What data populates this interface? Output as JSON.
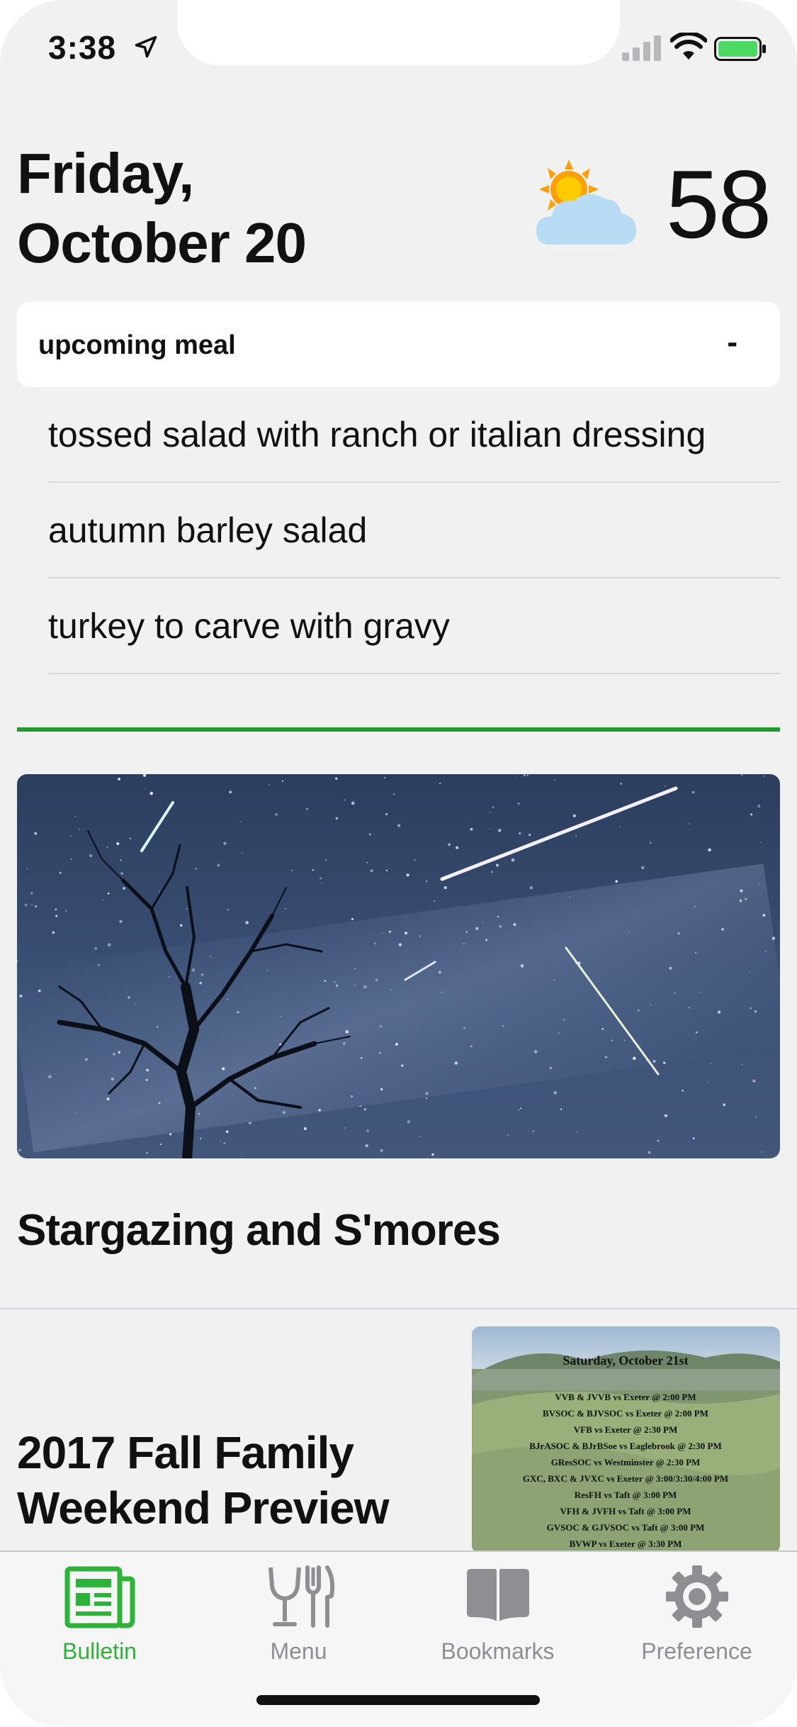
{
  "status_bar": {
    "time": "3:38"
  },
  "header": {
    "date_line1": "Friday,",
    "date_line2": "October 20",
    "temperature": "58",
    "weather_icon": "partly-cloudy-icon"
  },
  "meal": {
    "title": "upcoming meal",
    "toggle": "-",
    "items": [
      "tossed salad with ranch or italian dressing",
      "autumn barley salad",
      "turkey to carve with gravy"
    ]
  },
  "news": [
    {
      "title": "Stargazing and S'mores"
    },
    {
      "title_line1": "2017 Fall Family",
      "title_line2": "Weekend Preview",
      "thumbnail": {
        "heading": "Saturday, October 21st",
        "lines": [
          "VVB & JVVB vs Exeter @ 2:00 PM",
          "BVSOC & BJVSOC vs Exeter @ 2:00 PM",
          "VFB vs Exeter @ 2:30 PM",
          "BJrASOC & BJrBSoe vs Eaglebrook @ 2:30 PM",
          "GResSOC vs Westminster @ 2:30 PM",
          "GXC, BXC & JVXC vs Exeter @ 3:00/3:30/4:00 PM",
          "ResFH vs Taft @ 3:00 PM",
          "VFH & JVFH vs Taft @ 3:00 PM",
          "GVSOC & GJVSOC vs Taft @ 3:00 PM",
          "BVWP vs Exeter @ 3:30 PM"
        ]
      }
    }
  ],
  "tabbar": {
    "tabs": [
      {
        "label": "Bulletin",
        "icon": "newspaper-icon",
        "active": true
      },
      {
        "label": "Menu",
        "icon": "fork-knife-glass-icon",
        "active": false
      },
      {
        "label": "Bookmarks",
        "icon": "book-icon",
        "active": false
      },
      {
        "label": "Preference",
        "icon": "gear-icon",
        "active": false
      }
    ]
  },
  "colors": {
    "accent": "#2db337",
    "divider_green": "#229a2a",
    "inactive": "#8e8e93"
  }
}
